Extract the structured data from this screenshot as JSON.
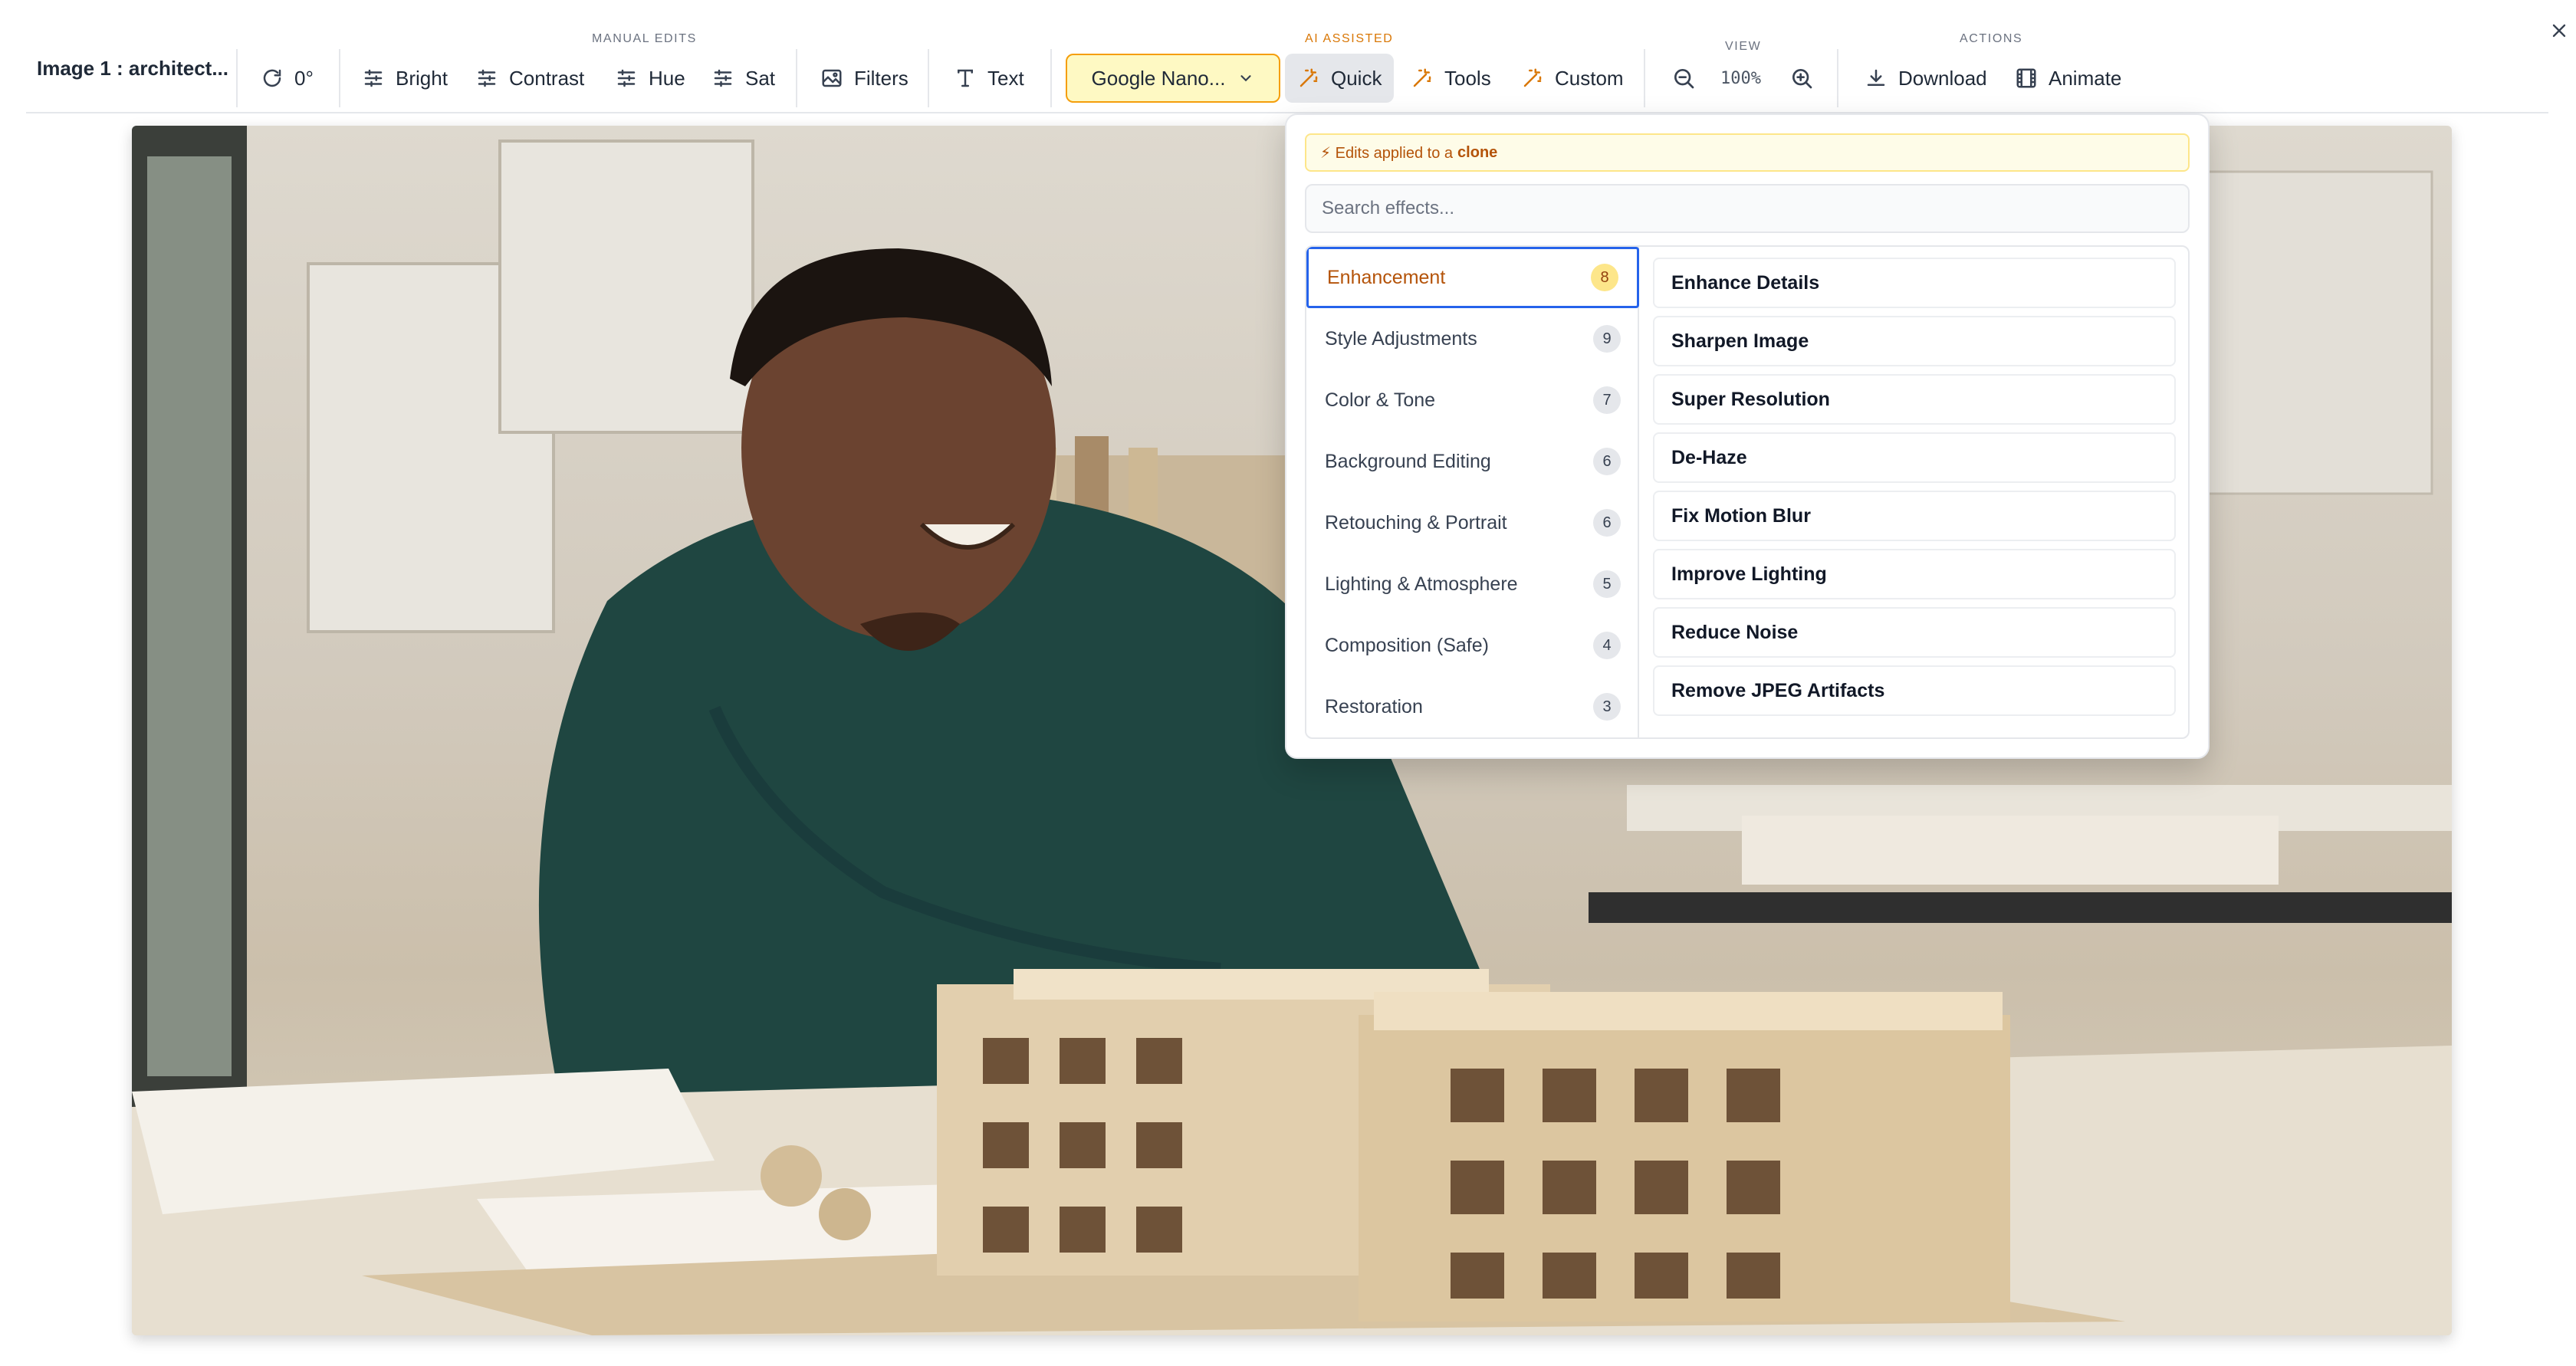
{
  "toolbar": {
    "image_title": "Image 1 : architect...",
    "rotate_label": "0°",
    "groups": {
      "manual": "MANUAL EDITS",
      "ai": "AI ASSISTED",
      "view": "VIEW",
      "actions": "ACTIONS"
    },
    "bright_label": "Bright",
    "contrast_label": "Contrast",
    "hue_label": "Hue",
    "sat_label": "Sat",
    "filters_label": "Filters",
    "text_label": "Text",
    "model_select_value": "Google Nano...",
    "quick_label": "Quick",
    "tools_label": "Tools",
    "custom_label": "Custom",
    "zoom_level": "100%",
    "download_label": "Download",
    "animate_label": "Animate"
  },
  "quick_panel": {
    "notice_prefix": "⚡ Edits applied to a",
    "notice_emphasis": "clone",
    "search_placeholder": "Search effects...",
    "categories": [
      {
        "label": "Enhancement",
        "count": "8"
      },
      {
        "label": "Style Adjustments",
        "count": "9"
      },
      {
        "label": "Color & Tone",
        "count": "7"
      },
      {
        "label": "Background Editing",
        "count": "6"
      },
      {
        "label": "Retouching & Portrait",
        "count": "6"
      },
      {
        "label": "Lighting & Atmosphere",
        "count": "5"
      },
      {
        "label": "Composition (Safe)",
        "count": "4"
      },
      {
        "label": "Restoration",
        "count": "3"
      }
    ],
    "effects": [
      "Enhance Details",
      "Sharpen Image",
      "Super Resolution",
      "De-Haze",
      "Fix Motion Blur",
      "Improve Lighting",
      "Reduce Noise",
      "Remove JPEG Artifacts"
    ]
  },
  "colors": {
    "accent_amber": "#f59e0b",
    "active_outline": "#2563eb",
    "notice_bg": "#fefce8"
  }
}
